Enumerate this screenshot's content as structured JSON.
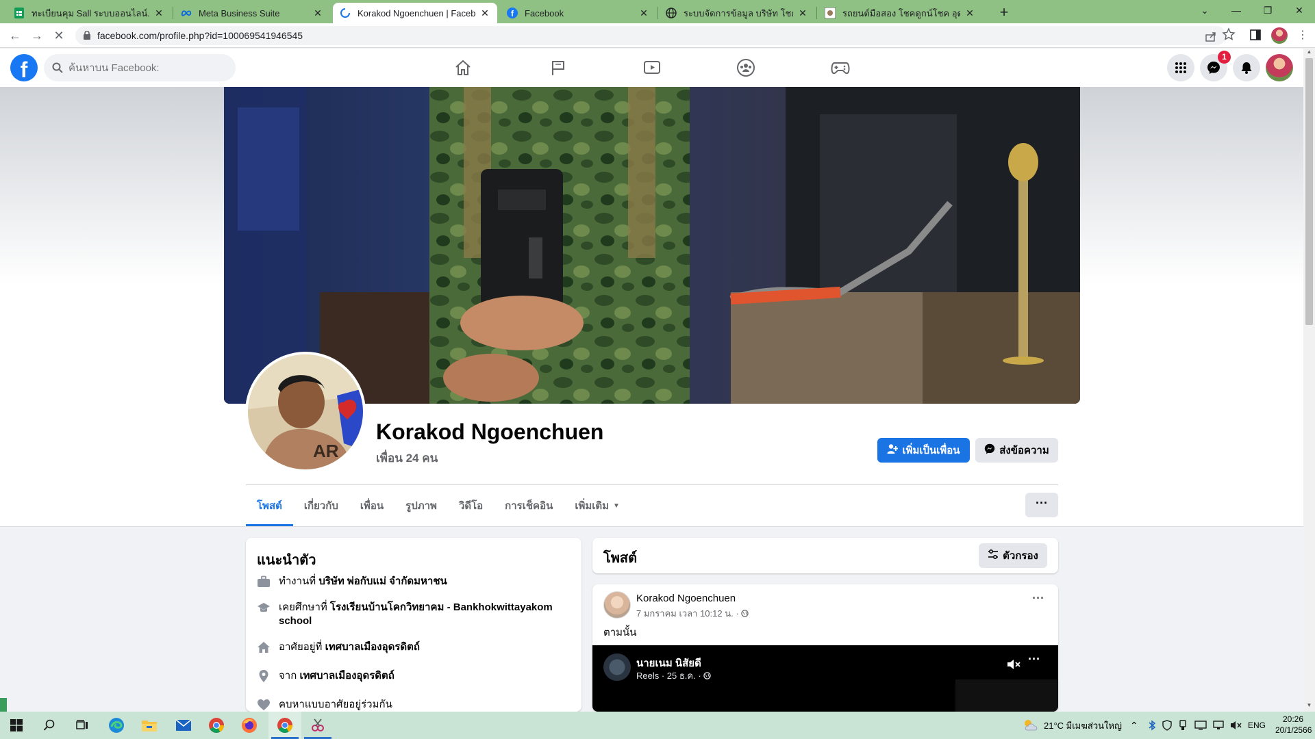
{
  "browser": {
    "tabs": [
      {
        "title": "ทะเบียนคุม Sall ระบบออนไลน์.xlsx - G",
        "icon": "sheets-icon"
      },
      {
        "title": "Meta Business Suite",
        "icon": "meta-icon"
      },
      {
        "title": "Korakod Ngoenchuen | Facebook",
        "icon": "loading-icon"
      },
      {
        "title": "Facebook",
        "icon": "facebook-icon"
      },
      {
        "title": "ระบบจัดการข้อมูล บริษัท โชคดูกน์โชค",
        "icon": "globe-icon"
      },
      {
        "title": "รถยนต์มือสอง โชคดูกน์โชค อุดรธานี",
        "icon": "site-icon"
      }
    ],
    "url": "facebook.com/profile.php?id=100069541946545"
  },
  "fb": {
    "search_placeholder": "ค้นหาบน Facebook:",
    "messenger_badge": "1"
  },
  "profile": {
    "name": "Korakod Ngoenchuen",
    "friends": "เพื่อน 24 คน",
    "add_friend": "เพิ่มเป็นเพื่อน",
    "message": "ส่งข้อความ",
    "tabs": [
      "โพสต์",
      "เกี่ยวกับ",
      "เพื่อน",
      "รูปภาพ",
      "วิดีโอ",
      "การเช็คอิน",
      "เพิ่มเติม"
    ],
    "more_dots": "···"
  },
  "intro": {
    "title": "แนะนำตัว",
    "rows": [
      {
        "prefix": "ทำงานที่ ",
        "value": "บริษัท พ่อกับแม่ จำกัดมหาชน",
        "icon": "briefcase-icon"
      },
      {
        "prefix": "เคยศึกษาที่ ",
        "value": "โรงเรียนบ้านโคกวิทยาคม - Bankhokwittayakom school",
        "icon": "graduation-cap-icon"
      },
      {
        "prefix": "อาศัยอยู่ที่ ",
        "value": "เทศบาลเมืองอุดรดิตถ์",
        "icon": "home-icon"
      },
      {
        "prefix": "จาก ",
        "value": "เทศบาลเมืองอุดรดิตถ์",
        "icon": "location-pin-icon"
      },
      {
        "prefix": "",
        "value": "คบหาแบบอาศัยอยู่ร่วมกัน",
        "icon": "heart-icon"
      }
    ]
  },
  "posts": {
    "title": "โพสต์",
    "filter": "ตัวกรอง",
    "items": [
      {
        "author": "Korakod Ngoenchuen",
        "meta": "7 มกราคม เวลา 10:12 น. ·",
        "text": "ตามนั้น",
        "shared": {
          "name": "นายเนม นิสัยดี",
          "meta": "Reels · 25 ธ.ค. ·"
        }
      }
    ]
  },
  "taskbar": {
    "weather": "21°C  มีเมฆส่วนใหญ่",
    "lang": "ENG",
    "time": "20:26",
    "date": "20/1/2566"
  }
}
